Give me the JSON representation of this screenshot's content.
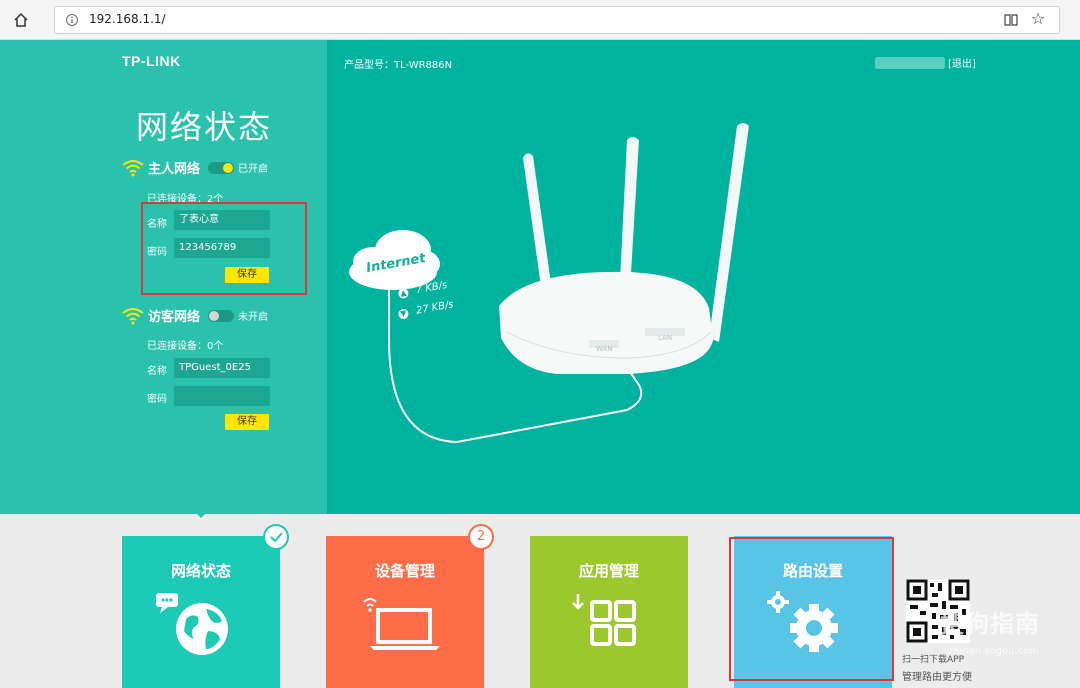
{
  "browser": {
    "url": "192.168.1.1/",
    "icons": [
      "home-icon",
      "info-icon",
      "reader-icon",
      "star-icon"
    ]
  },
  "header": {
    "brand": "TP-LINK",
    "model": "产品型号：TL-WR886N",
    "logout": "[退出]"
  },
  "status": {
    "title": "网络状态",
    "main": {
      "title": "主人网络",
      "state": "已开启",
      "connected": "已连接设备：2个",
      "name_label": "名称",
      "name_value": "了表心意",
      "pwd_label": "密码",
      "pwd_value": "123456789",
      "save": "保存"
    },
    "guest": {
      "title": "访客网络",
      "state": "未开启",
      "connected": "已连接设备：0个",
      "name_label": "名称",
      "name_value": "TPGuest_0E25",
      "pwd_label": "密码",
      "pwd_value": "",
      "save": "保存"
    }
  },
  "diagram": {
    "cloud_label": "Internet",
    "upload": "7 KB/s",
    "download": "27 KB/s",
    "wan": "WAN",
    "lan": "LAN"
  },
  "tiles": {
    "network": "网络状态",
    "devices": "设备管理",
    "devices_badge": "2",
    "apps": "应用管理",
    "router": "路由设置"
  },
  "app_promo": {
    "line1": "扫一扫下载APP",
    "line2": "管理路由更方便"
  },
  "watermark": {
    "text": "搜狗指南",
    "url": "zhinan.sogou.com"
  },
  "colors": {
    "teal": "#00b39e",
    "teal_light": "#2bc2ad",
    "tile_network": "#1ccab6",
    "tile_devices": "#ff6d48",
    "tile_apps": "#9bc82d",
    "tile_router": "#58c5e7",
    "highlight": "#e0353b",
    "save": "#ffe600"
  }
}
